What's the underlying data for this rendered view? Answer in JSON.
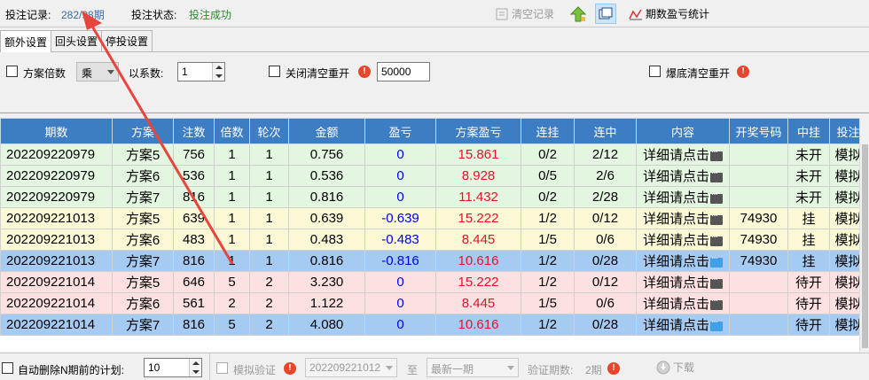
{
  "topbar": {
    "record_label": "投注记录:",
    "record_value": "282/98期",
    "status_label": "投注状态:",
    "status_value": "投注成功",
    "clear_label": "清空记录",
    "stats_label": "期数盈亏统计"
  },
  "tabs": [
    {
      "label": "额外设置",
      "active": true
    },
    {
      "label": "回头设置",
      "active": false
    },
    {
      "label": "停投设置",
      "active": false
    }
  ],
  "settings": {
    "plan_multiple_label": "方案倍数",
    "operator_value": "乘",
    "coef_label": "以系数:",
    "coef_value": "1",
    "close_reset_label": "关闭清空重开",
    "close_reset_value": "50000",
    "bottom_reset_label": "爆底清空重开"
  },
  "grid": {
    "columns": [
      "期数",
      "方案",
      "注数",
      "倍数",
      "轮次",
      "金额",
      "盈亏",
      "方案盈亏",
      "连挂",
      "连中",
      "内容",
      "开奖号码",
      "中挂",
      "投注"
    ],
    "rows": [
      {
        "style": "green",
        "cells": [
          "202209220979",
          "方案5",
          "756",
          "1",
          "1",
          "0.756",
          "0",
          "15.861",
          "0/2",
          "2/12",
          "详细请点击",
          "",
          "未开",
          "模拟"
        ]
      },
      {
        "style": "green",
        "cells": [
          "202209220979",
          "方案6",
          "536",
          "1",
          "1",
          "0.536",
          "0",
          "8.928",
          "0/5",
          "2/6",
          "详细请点击",
          "",
          "未开",
          "模拟"
        ]
      },
      {
        "style": "green",
        "cells": [
          "202209220979",
          "方案7",
          "816",
          "1",
          "1",
          "0.816",
          "0",
          "11.432",
          "0/2",
          "2/28",
          "详细请点击",
          "",
          "未开",
          "模拟"
        ]
      },
      {
        "style": "yellow",
        "cells": [
          "202209221013",
          "方案5",
          "639",
          "1",
          "1",
          "0.639",
          "-0.639",
          "15.222",
          "1/2",
          "0/12",
          "详细请点击",
          "74930",
          "挂",
          "模拟"
        ]
      },
      {
        "style": "yellow",
        "cells": [
          "202209221013",
          "方案6",
          "483",
          "1",
          "1",
          "0.483",
          "-0.483",
          "8.445",
          "1/5",
          "0/6",
          "详细请点击",
          "74930",
          "挂",
          "模拟"
        ]
      },
      {
        "style": "blue",
        "cells": [
          "202209221013",
          "方案7",
          "816",
          "1",
          "1",
          "0.816",
          "-0.816",
          "10.616",
          "1/2",
          "0/28",
          "详细请点击",
          "74930",
          "挂",
          "模拟"
        ]
      },
      {
        "style": "pink",
        "cells": [
          "202209221014",
          "方案5",
          "646",
          "5",
          "2",
          "3.230",
          "0",
          "15.222",
          "1/2",
          "0/12",
          "详细请点击",
          "",
          "待开",
          "模拟"
        ]
      },
      {
        "style": "pink",
        "cells": [
          "202209221014",
          "方案6",
          "561",
          "2",
          "2",
          "1.122",
          "0",
          "8.445",
          "1/5",
          "0/6",
          "详细请点击",
          "",
          "待开",
          "模拟"
        ]
      },
      {
        "style": "blue",
        "cells": [
          "202209221014",
          "方案7",
          "816",
          "5",
          "2",
          "4.080",
          "0",
          "10.616",
          "1/2",
          "0/28",
          "详细请点击",
          "",
          "待开",
          "模拟"
        ]
      }
    ]
  },
  "bottombar": {
    "auto_delete_label": "自动删除N期前的计划:",
    "auto_delete_value": "10",
    "sim_verify_label": "模拟验证",
    "from_value": "202209221012",
    "to_label": "至",
    "to_value": "最新一期",
    "verify_count_label": "验证期数:",
    "verify_count_value": "2期",
    "download_label": "下载"
  },
  "colors": {
    "header_bg": "#3d7dc4",
    "row_green": "#e3f7e0",
    "row_yellow": "#fbf8d6",
    "row_pink": "#fde0e0",
    "row_blue": "#a5cbf2",
    "annotation_arrow": "#e8453c"
  },
  "icons": [
    "clear-icon",
    "up-arrow-icon",
    "window-icon",
    "chart-icon",
    "warning-icon",
    "detail-icon",
    "download-icon"
  ]
}
